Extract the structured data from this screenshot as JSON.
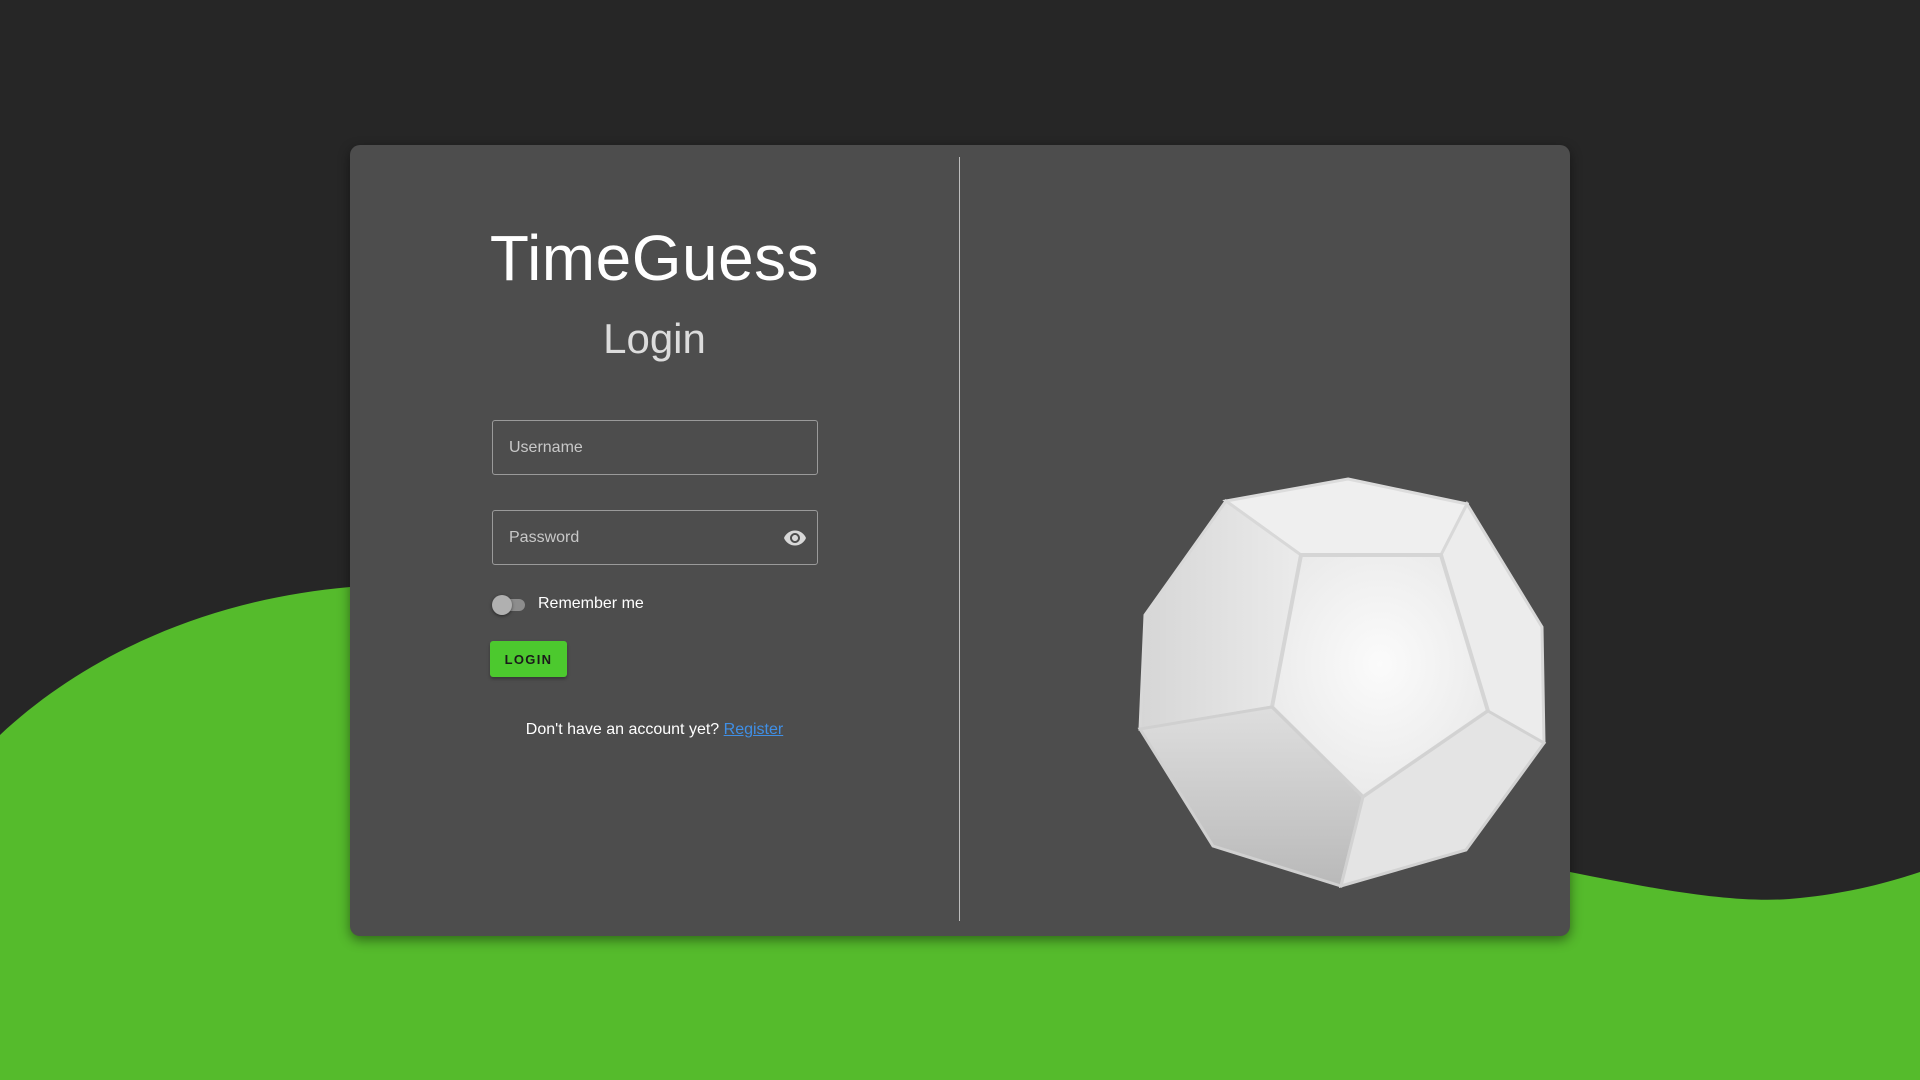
{
  "colors": {
    "background_dark": "#262626",
    "background_green": "#55bb2c",
    "card": "#4d4d4d",
    "accent": "#4cc92e",
    "link": "#3f8fe6"
  },
  "app": {
    "title": "TimeGuess"
  },
  "login_form": {
    "heading": "Login",
    "username_placeholder": "Username",
    "username_value": "",
    "password_placeholder": "Password",
    "password_value": "",
    "password_visibility_icon": "eye-icon",
    "remember_me_label": "Remember me",
    "remember_me_checked": false,
    "login_button_label": "LOGIN",
    "register_prompt": "Don't have an account yet?",
    "register_link_label": "Register"
  },
  "illustration": {
    "name": "dodecahedron"
  }
}
